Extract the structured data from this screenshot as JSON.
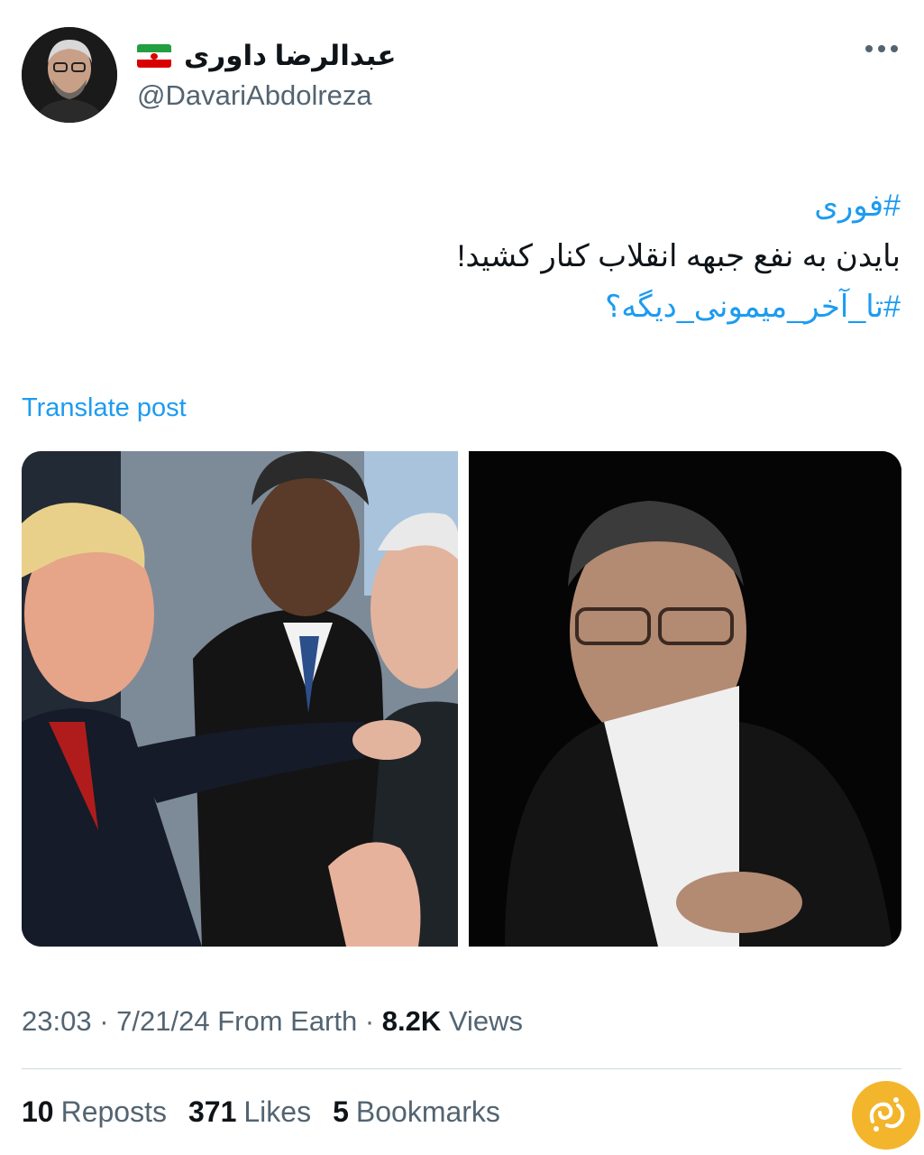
{
  "user": {
    "display_name": "عبدالرضا داوری",
    "handle": "@DavariAbdolreza",
    "avatar_icon": "avatar-photo",
    "flag_icon": "iran-flag-icon"
  },
  "tweet": {
    "hashtag_top": "#فوری",
    "body": "بایدن به نفع جبهه انقلاب کنار کشید!",
    "hashtag_bottom": "#تا_آخر_میمونی_دیگه؟",
    "translate_label": "Translate post"
  },
  "meta": {
    "time": "23:03",
    "date": "7/21/24",
    "source": "From Earth",
    "views_count": "8.2K",
    "views_label": "Views"
  },
  "stats": {
    "reposts_count": "10",
    "reposts_label": "Reposts",
    "likes_count": "371",
    "likes_label": "Likes",
    "bookmarks_count": "5",
    "bookmarks_label": "Bookmarks"
  },
  "colors": {
    "link": "#1d9bf0",
    "secondary": "#536471",
    "primary_text": "#0f1419",
    "divider": "#cfd9de"
  }
}
